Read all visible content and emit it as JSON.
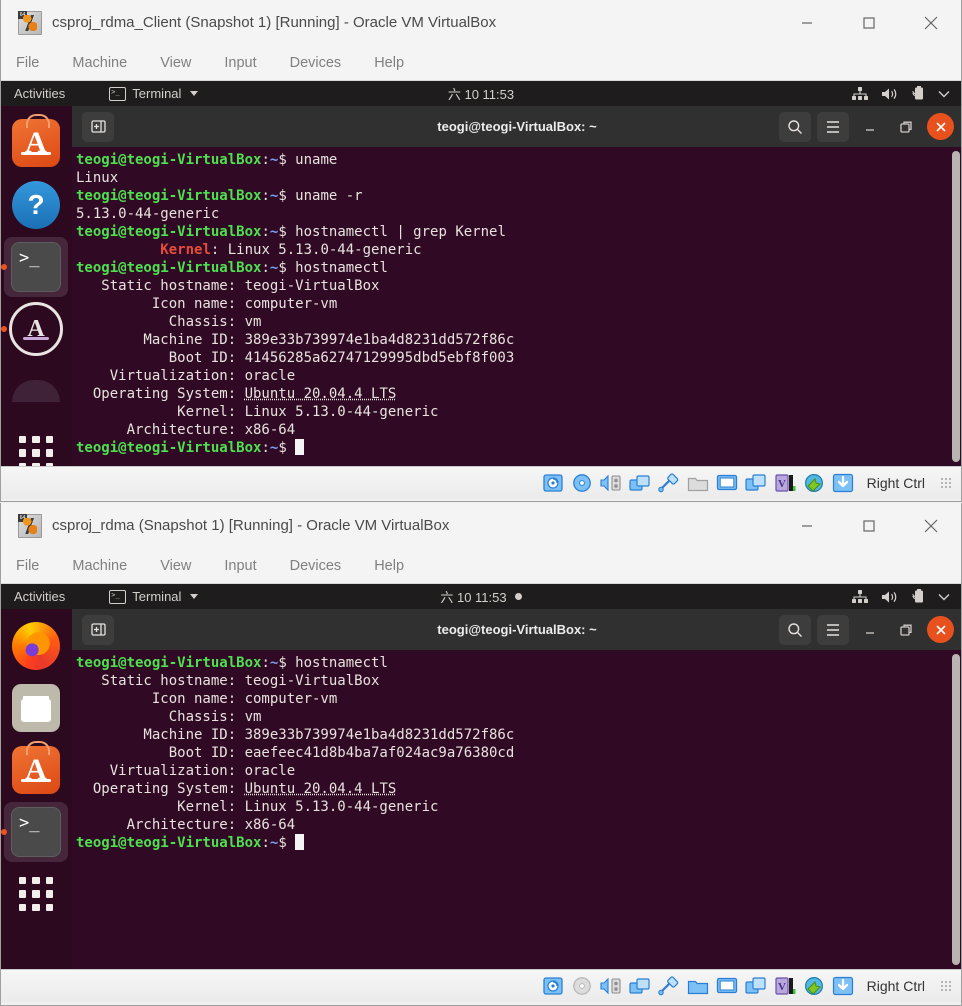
{
  "windows": [
    {
      "title": "csproj_rdma_Client (Snapshot 1) [Running] - Oracle VM VirtualBox",
      "icon_badge": "64",
      "menu": [
        "File",
        "Machine",
        "View",
        "Input",
        "Devices",
        "Help"
      ],
      "controls": {
        "minimize": "minimize-icon",
        "maximize": "maximize-icon",
        "close": "close-icon"
      },
      "gnome": {
        "activities": "Activities",
        "app_name": "Terminal",
        "clock": "六 10 11:53",
        "notification_dot": false,
        "tray": [
          "network-icon",
          "volume-icon",
          "battery-icon",
          "chevron-down-icon"
        ]
      },
      "dock": [
        {
          "name": "ubuntu-software",
          "running": false,
          "active": false
        },
        {
          "name": "help",
          "running": false,
          "active": false
        },
        {
          "name": "terminal",
          "running": true,
          "active": true
        },
        {
          "name": "ubuntu-installer",
          "running": true,
          "active": false
        },
        {
          "name": "partial-app",
          "running": false,
          "active": false
        },
        {
          "name": "show-applications",
          "running": false,
          "active": false
        }
      ],
      "terminal": {
        "title": "teogi@teogi-VirtualBox: ~",
        "buttons": [
          "new-tab-icon",
          "search-icon",
          "menu-icon",
          "minimize-icon",
          "restore-icon",
          "close-icon"
        ],
        "lines": [
          [
            {
              "t": "teogi@teogi-VirtualBox",
              "c": "prompt"
            },
            {
              "t": ":",
              "c": "plain"
            },
            {
              "t": "~",
              "c": "path"
            },
            {
              "t": "$ uname",
              "c": "plain"
            }
          ],
          [
            {
              "t": "Linux",
              "c": "plain"
            }
          ],
          [
            {
              "t": "teogi@teogi-VirtualBox",
              "c": "prompt"
            },
            {
              "t": ":",
              "c": "plain"
            },
            {
              "t": "~",
              "c": "path"
            },
            {
              "t": "$ uname -r",
              "c": "plain"
            }
          ],
          [
            {
              "t": "5.13.0-44-generic",
              "c": "plain"
            }
          ],
          [
            {
              "t": "teogi@teogi-VirtualBox",
              "c": "prompt"
            },
            {
              "t": ":",
              "c": "plain"
            },
            {
              "t": "~",
              "c": "path"
            },
            {
              "t": "$ hostnamectl | grep Kernel",
              "c": "plain"
            }
          ],
          [
            {
              "t": "          ",
              "c": "plain"
            },
            {
              "t": "Kernel",
              "c": "red"
            },
            {
              "t": ": Linux 5.13.0-44-generic",
              "c": "plain"
            }
          ],
          [
            {
              "t": "teogi@teogi-VirtualBox",
              "c": "prompt"
            },
            {
              "t": ":",
              "c": "plain"
            },
            {
              "t": "~",
              "c": "path"
            },
            {
              "t": "$ hostnamectl",
              "c": "plain"
            }
          ],
          [
            {
              "t": "   Static hostname: teogi-VirtualBox",
              "c": "plain"
            }
          ],
          [
            {
              "t": "         Icon name: computer-vm",
              "c": "plain"
            }
          ],
          [
            {
              "t": "           Chassis: vm",
              "c": "plain"
            }
          ],
          [
            {
              "t": "        Machine ID: 389e33b739974e1ba4d8231dd572f86c",
              "c": "plain"
            }
          ],
          [
            {
              "t": "           Boot ID: 41456285a62747129995dbd5ebf8f003",
              "c": "plain"
            }
          ],
          [
            {
              "t": "    Virtualization: oracle",
              "c": "plain"
            }
          ],
          [
            {
              "t": "  Operating System: ",
              "c": "plain"
            },
            {
              "t": "Ubuntu 20.04.4 LTS",
              "c": "ul"
            }
          ],
          [
            {
              "t": "            Kernel: Linux 5.13.0-44-generic",
              "c": "plain"
            }
          ],
          [
            {
              "t": "      Architecture: x86-64",
              "c": "plain"
            }
          ],
          [
            {
              "t": "teogi@teogi-VirtualBox",
              "c": "prompt"
            },
            {
              "t": ":",
              "c": "plain"
            },
            {
              "t": "~",
              "c": "path"
            },
            {
              "t": "$ ",
              "c": "plain"
            },
            {
              "t": "",
              "c": "cursor"
            }
          ]
        ]
      },
      "status_bar": {
        "icons": [
          "hard-disk-icon",
          "optical-disk-icon",
          "audio-icon",
          "network-adapter-icon",
          "usb-icon",
          "shared-folders-icon",
          "display-icon",
          "remote-desktop-icon",
          "video-capture-icon",
          "mouse-integration-icon",
          "guest-additions-icon"
        ],
        "host_key": "Right Ctrl",
        "optical_disk_active": true,
        "shared_folder_active": false
      }
    },
    {
      "title": "csproj_rdma (Snapshot 1) [Running] - Oracle VM VirtualBox",
      "icon_badge": "64",
      "menu": [
        "File",
        "Machine",
        "View",
        "Input",
        "Devices",
        "Help"
      ],
      "controls": {
        "minimize": "minimize-icon",
        "maximize": "maximize-icon",
        "close": "close-icon"
      },
      "gnome": {
        "activities": "Activities",
        "app_name": "Terminal",
        "clock": "六 10 11:53",
        "notification_dot": true,
        "tray": [
          "network-icon",
          "volume-icon",
          "battery-icon",
          "chevron-down-icon"
        ]
      },
      "dock": [
        {
          "name": "firefox",
          "running": false,
          "active": false
        },
        {
          "name": "files",
          "running": false,
          "active": false
        },
        {
          "name": "ubuntu-software",
          "running": false,
          "active": false
        },
        {
          "name": "terminal",
          "running": true,
          "active": true
        },
        {
          "name": "show-applications",
          "running": false,
          "active": false
        }
      ],
      "terminal": {
        "title": "teogi@teogi-VirtualBox: ~",
        "buttons": [
          "new-tab-icon",
          "search-icon",
          "menu-icon",
          "minimize-icon",
          "restore-icon",
          "close-icon"
        ],
        "lines": [
          [
            {
              "t": "teogi@teogi-VirtualBox",
              "c": "prompt"
            },
            {
              "t": ":",
              "c": "plain"
            },
            {
              "t": "~",
              "c": "path"
            },
            {
              "t": "$ hostnamectl",
              "c": "plain"
            }
          ],
          [
            {
              "t": "   Static hostname: teogi-VirtualBox",
              "c": "plain"
            }
          ],
          [
            {
              "t": "         Icon name: computer-vm",
              "c": "plain"
            }
          ],
          [
            {
              "t": "           Chassis: vm",
              "c": "plain"
            }
          ],
          [
            {
              "t": "        Machine ID: 389e33b739974e1ba4d8231dd572f86c",
              "c": "plain"
            }
          ],
          [
            {
              "t": "           Boot ID: eaefeec41d8b4ba7af024ac9a76380cd",
              "c": "plain"
            }
          ],
          [
            {
              "t": "    Virtualization: oracle",
              "c": "plain"
            }
          ],
          [
            {
              "t": "  Operating System: ",
              "c": "plain"
            },
            {
              "t": "Ubuntu 20.04.4 LTS",
              "c": "ul"
            }
          ],
          [
            {
              "t": "            Kernel: Linux 5.13.0-44-generic",
              "c": "plain"
            }
          ],
          [
            {
              "t": "      Architecture: x86-64",
              "c": "plain"
            }
          ],
          [
            {
              "t": "teogi@teogi-VirtualBox",
              "c": "prompt"
            },
            {
              "t": ":",
              "c": "plain"
            },
            {
              "t": "~",
              "c": "path"
            },
            {
              "t": "$ ",
              "c": "plain"
            },
            {
              "t": "",
              "c": "cursor"
            }
          ]
        ]
      },
      "status_bar": {
        "icons": [
          "hard-disk-icon",
          "optical-disk-icon",
          "audio-icon",
          "network-adapter-icon",
          "usb-icon",
          "shared-folders-icon",
          "display-icon",
          "remote-desktop-icon",
          "video-capture-icon",
          "mouse-integration-icon",
          "guest-additions-icon"
        ],
        "host_key": "Right Ctrl",
        "optical_disk_active": false,
        "shared_folder_active": true
      }
    }
  ],
  "colors": {
    "terminal_bg": "#300a24",
    "prompt_green": "#4ee04e",
    "path_blue": "#7a9ff5",
    "kernel_red": "#e44c3c",
    "ubuntu_orange": "#e8511d",
    "panel_dark": "#1e1c1c"
  }
}
